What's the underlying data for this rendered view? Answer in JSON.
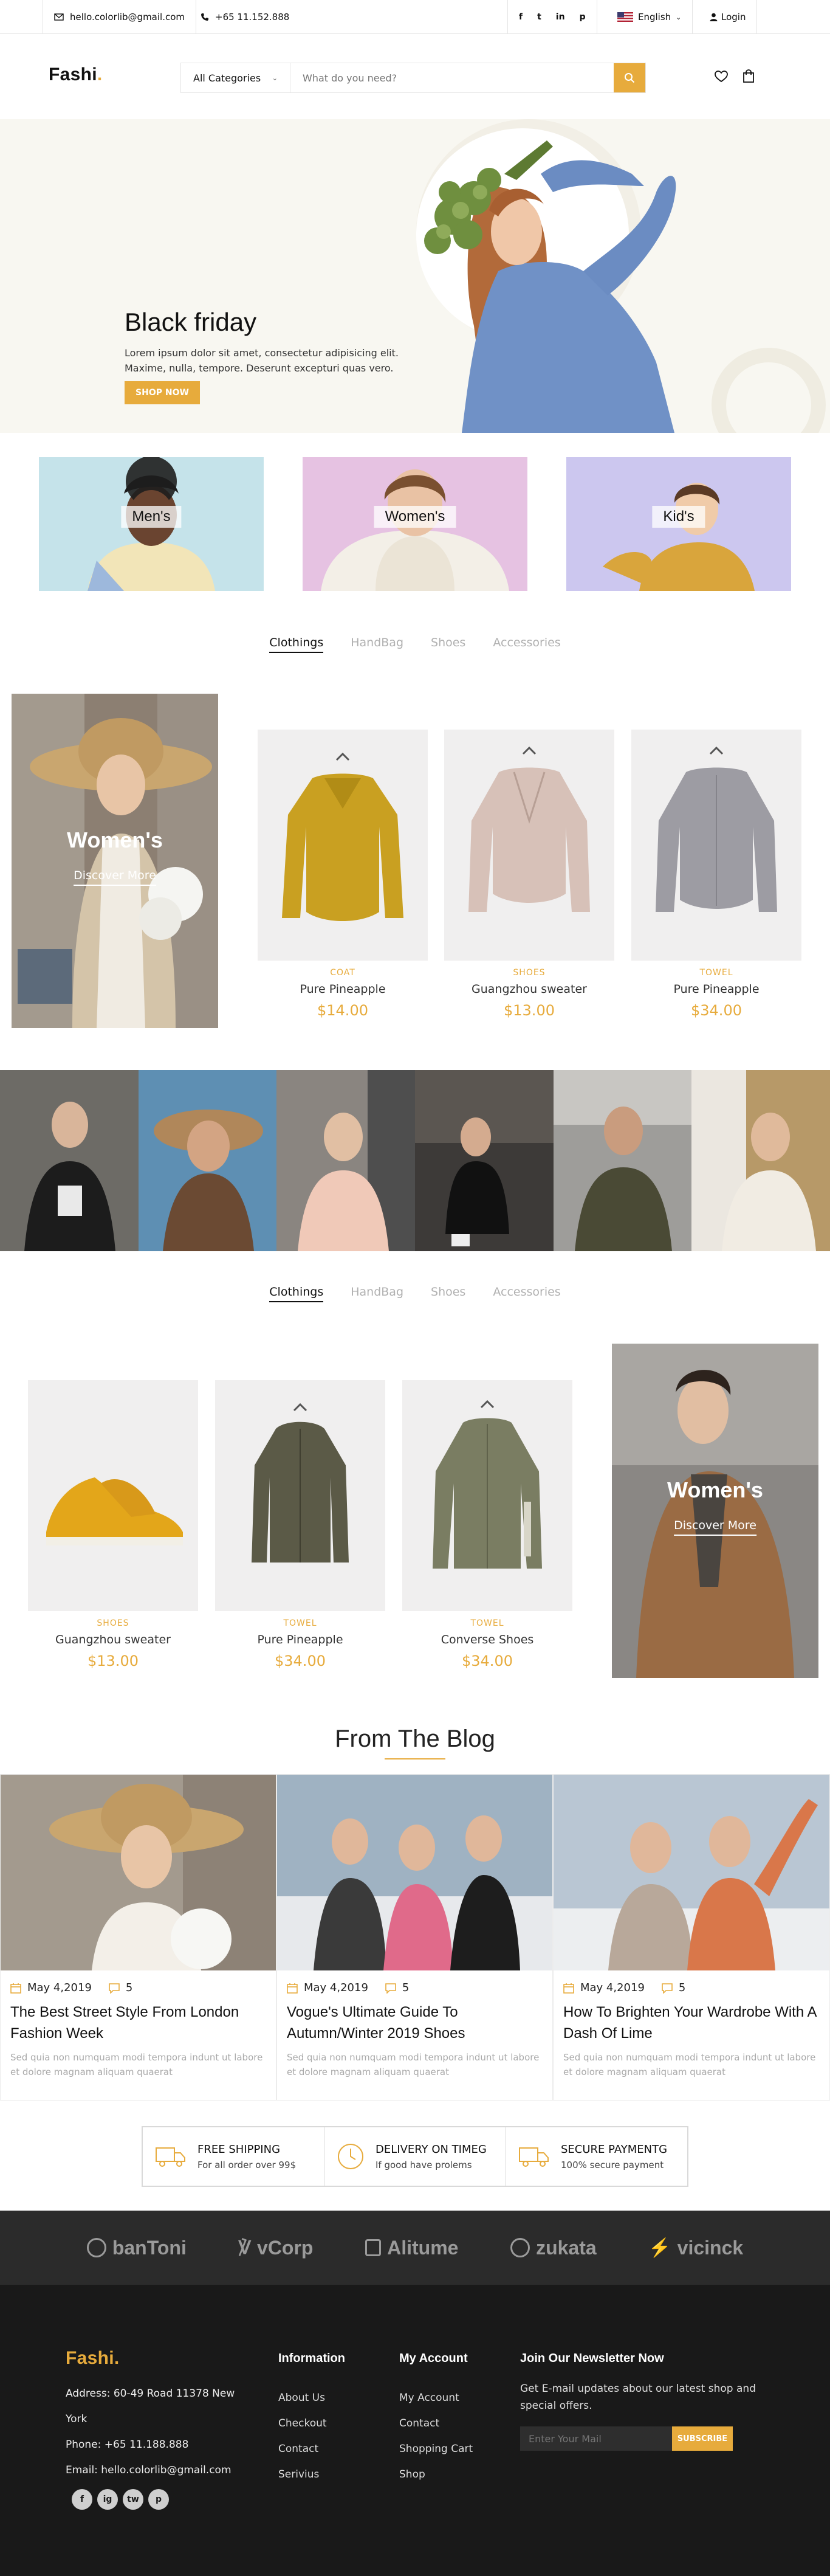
{
  "topbar": {
    "email": "hello.colorlib@gmail.com",
    "phone": "+65 11.152.888",
    "social": [
      "f",
      "t",
      "in",
      "p"
    ],
    "language": "English",
    "login": "Login"
  },
  "header": {
    "logo": "Fashi",
    "logo_dot": ".",
    "category": "All Categories",
    "search_placeholder": "What do you need?"
  },
  "hero": {
    "title": "Black friday",
    "text": "Lorem ipsum dolor sit amet, consectetur adipisicing elit. Maxime, nulla, tempore. Deserunt excepturi quas vero.",
    "button": "SHOP NOW"
  },
  "banners": [
    "Men's",
    "Women's",
    "Kid's"
  ],
  "tabs": [
    "Clothings",
    "HandBag",
    "Shoes",
    "Accessories"
  ],
  "women_promo": {
    "title": "Women's",
    "link": "Discover More"
  },
  "products1": [
    {
      "category": "COAT",
      "name": "Pure Pineapple",
      "price": "$14.00"
    },
    {
      "category": "SHOES",
      "name": "Guangzhou sweater",
      "price": "$13.00"
    },
    {
      "category": "TOWEL",
      "name": "Pure Pineapple",
      "price": "$34.00"
    }
  ],
  "products2": [
    {
      "category": "SHOES",
      "name": "Guangzhou sweater",
      "price": "$13.00"
    },
    {
      "category": "TOWEL",
      "name": "Pure Pineapple",
      "price": "$34.00"
    },
    {
      "category": "TOWEL",
      "name": "Converse Shoes",
      "price": "$34.00"
    }
  ],
  "men_promo": {
    "title": "Women's",
    "link": "Discover More"
  },
  "blog": {
    "title": "From The Blog",
    "posts": [
      {
        "date": "May 4,2019",
        "comments": "5",
        "title": "The Best Street Style From London Fashion Week",
        "excerpt": "Sed quia non numquam modi tempora indunt ut labore et dolore magnam aliquam quaerat"
      },
      {
        "date": "May 4,2019",
        "comments": "5",
        "title": "Vogue's Ultimate Guide To Autumn/Winter 2019 Shoes",
        "excerpt": "Sed quia non numquam modi tempora indunt ut labore et dolore magnam aliquam quaerat"
      },
      {
        "date": "May 4,2019",
        "comments": "5",
        "title": "How To Brighten Your Wardrobe With A Dash Of Lime",
        "excerpt": "Sed quia non numquam modi tempora indunt ut labore et dolore magnam aliquam quaerat"
      }
    ]
  },
  "features": [
    {
      "title": "FREE SHIPPING",
      "sub": "For all order over 99$"
    },
    {
      "title": "DELIVERY ON TIMEG",
      "sub": "If good have prolems"
    },
    {
      "title": "SECURE PAYMENTG",
      "sub": "100% secure payment"
    }
  ],
  "partners": [
    "banToni",
    "vCorp",
    "Alitume",
    "zukata",
    "vicinck"
  ],
  "footer": {
    "logo": "Fashi",
    "address": "Address: 60-49 Road 11378 New York",
    "phone": "Phone: +65 11.188.888",
    "email": "Email: hello.colorlib@gmail.com",
    "social": [
      "f",
      "ig",
      "tw",
      "p"
    ],
    "info_title": "Information",
    "info_links": [
      "About Us",
      "Checkout",
      "Contact",
      "Serivius"
    ],
    "account_title": "My Account",
    "account_links": [
      "My Account",
      "Contact",
      "Shopping Cart",
      "Shop"
    ],
    "newsletter_title": "Join Our Newsletter Now",
    "newsletter_text": "Get E-mail updates about our latest shop and special offers.",
    "newsletter_placeholder": "Enter Your Mail",
    "subscribe": "SUBSCRIBE"
  },
  "colors": {
    "accent": "#e7ab3c",
    "dark": "#191919"
  }
}
